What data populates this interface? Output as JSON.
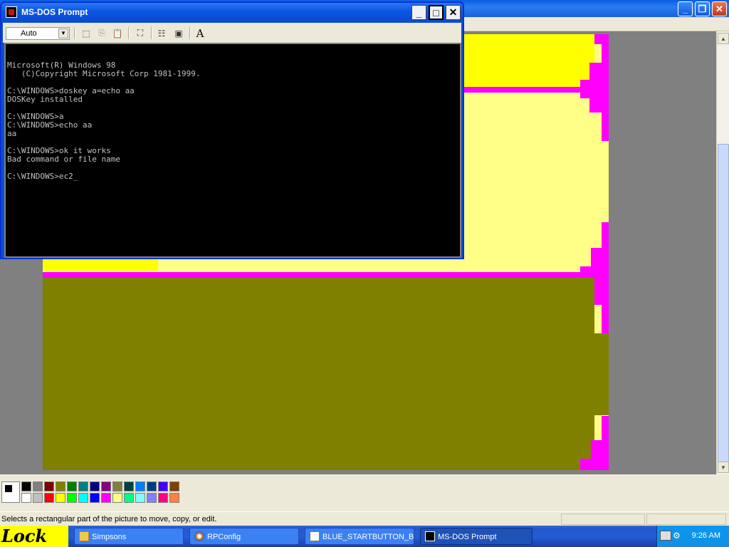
{
  "dos": {
    "title": "MS-DOS Prompt",
    "font_size": "Auto",
    "lines": [
      "Microsoft(R) Windows 98",
      "   (C)Copyright Microsoft Corp 1981-1999.",
      "",
      "C:\\WINDOWS>doskey a=echo aa",
      "DOSKey installed",
      "",
      "C:\\WINDOWS>a",
      "C:\\WINDOWS>echo aa",
      "aa",
      "",
      "C:\\WINDOWS>ok it works",
      "Bad command or file name",
      "",
      "C:\\WINDOWS>ec2_"
    ]
  },
  "paint": {
    "status_text": "Selects a rectangular part of the picture to move, copy, or edit.",
    "palette_top": [
      "#000000",
      "#808080",
      "#800000",
      "#808000",
      "#008000",
      "#008080",
      "#000080",
      "#800080",
      "#808040",
      "#004040",
      "#0080ff",
      "#004080",
      "#4000ff",
      "#804000"
    ],
    "palette_bottom": [
      "#ffffff",
      "#c0c0c0",
      "#ff0000",
      "#ffff00",
      "#00ff00",
      "#00ffff",
      "#0000ff",
      "#ff00ff",
      "#ffff80",
      "#00ff80",
      "#80ffff",
      "#8080ff",
      "#ff0080",
      "#ff8040"
    ],
    "canvas_colors": {
      "yellow": "#ffff00",
      "light_yellow": "#ffff88",
      "magenta": "#ff00ff",
      "olive": "#808000"
    }
  },
  "taskbar": {
    "start_label": "Lock",
    "tasks": [
      {
        "label": "Simpsons",
        "icon": "folder-icon"
      },
      {
        "label": "RPConfig",
        "icon": "config-icon"
      },
      {
        "label": "BLUE_STARTBUTTON_B...",
        "icon": "paint-icon"
      },
      {
        "label": "MS-DOS Prompt",
        "icon": "msdos-icon"
      }
    ],
    "clock": "9:26 AM"
  }
}
